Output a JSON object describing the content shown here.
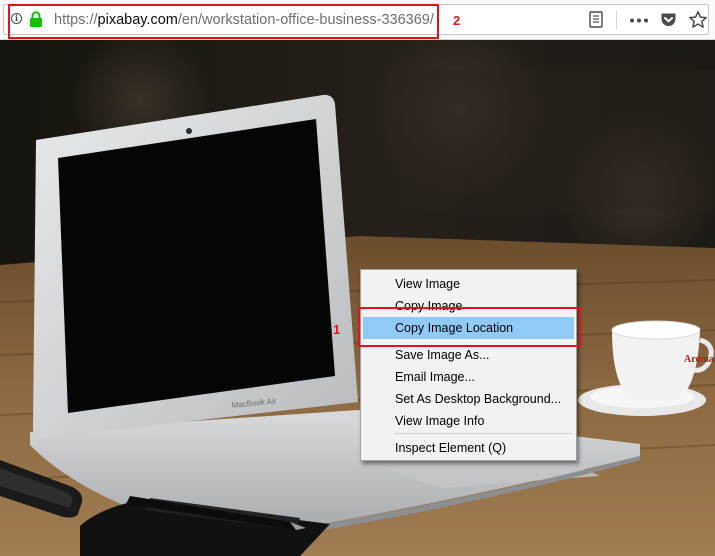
{
  "browser": {
    "url_prefix": "https://",
    "url_host": "pixabay.com",
    "url_path": "/en/workstation-office-business-336369/",
    "icons": [
      "info-icon",
      "lock-icon",
      "reader-view-icon",
      "more-actions-icon",
      "pocket-icon",
      "bookmark-star-icon"
    ]
  },
  "context_menu": {
    "items": [
      {
        "label": "View Image",
        "highlighted": false
      },
      {
        "label": "Copy Image",
        "highlighted": false
      },
      {
        "label": "Copy Image Location",
        "highlighted": true
      },
      {
        "label": "Save Image As...",
        "highlighted": false
      },
      {
        "label": "Email Image...",
        "highlighted": false
      },
      {
        "label": "Set As Desktop Background...",
        "highlighted": false
      },
      {
        "label": "View Image Info",
        "highlighted": false
      },
      {
        "label": "Inspect Element (Q)",
        "highlighted": false
      }
    ]
  },
  "annotations": {
    "label_1": "1",
    "label_2": "2",
    "color": "#e0141e"
  },
  "photo": {
    "laptop_label": "MacBook Air",
    "cup_label": "Aroma"
  },
  "colors": {
    "highlight": "#91c9f7",
    "lock": "#12bc00",
    "menu_bg": "#f2f2f2"
  }
}
